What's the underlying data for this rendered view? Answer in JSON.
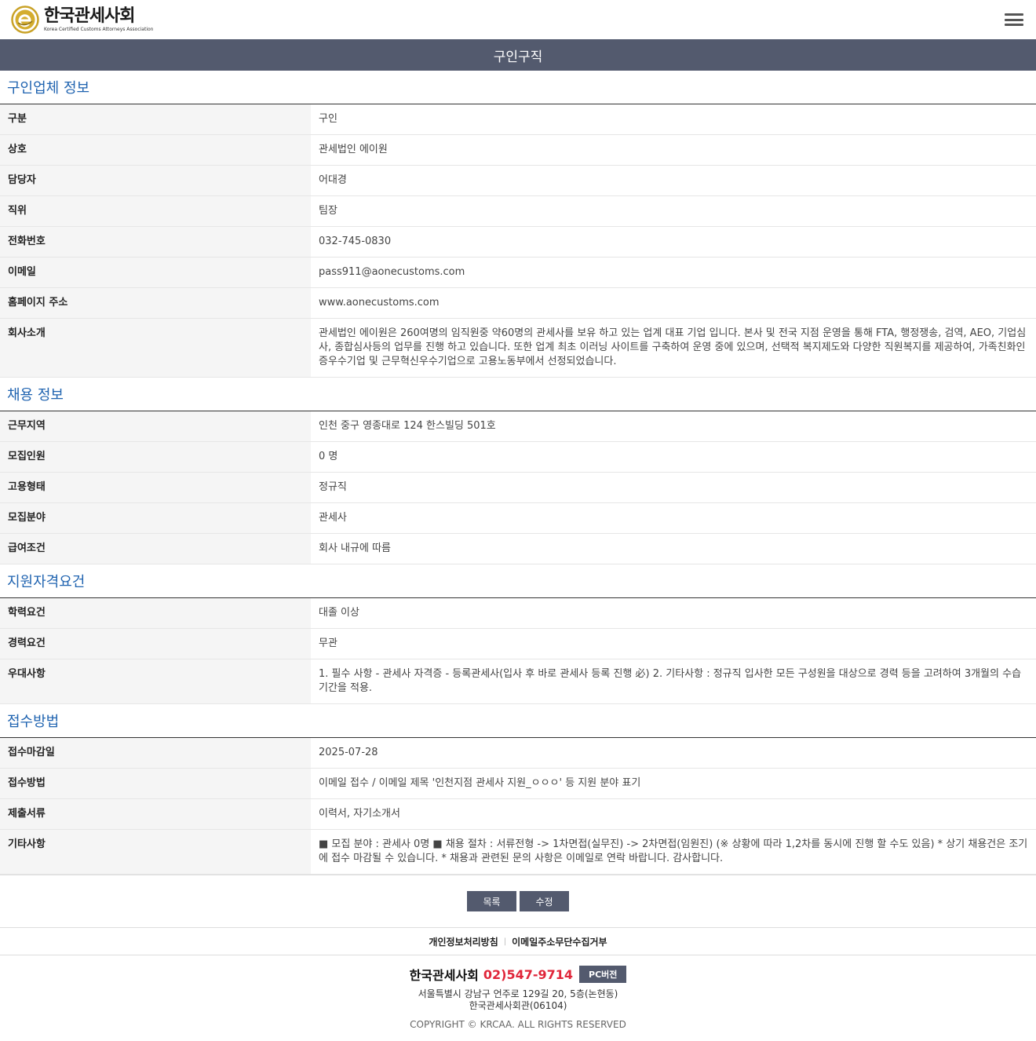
{
  "header": {
    "logo_ko": "한국관세사회",
    "logo_en": "Korea Certified Customs Attorneys Association"
  },
  "page_title": "구인구직",
  "sections": [
    {
      "title": "구인업체 정보",
      "rows": [
        {
          "label": "구분",
          "value": "구인"
        },
        {
          "label": "상호",
          "value": "관세법인 에이원"
        },
        {
          "label": "담당자",
          "value": "어대경"
        },
        {
          "label": "직위",
          "value": "팀장"
        },
        {
          "label": "전화번호",
          "value": "032-745-0830"
        },
        {
          "label": "이메일",
          "value": "pass911@aonecustoms.com"
        },
        {
          "label": "홈페이지 주소",
          "value": "www.aonecustoms.com"
        },
        {
          "label": "회사소개",
          "value": "관세법인 에이원은 260여명의 임직원중 약60명의 관세사를 보유 하고 있는 업계 대표 기업 입니다. 본사 및 전국 지점 운영을 통해 FTA, 행정쟁송, 검역, AEO, 기업심사, 종합심사등의 업무를 진행 하고 있습니다. 또한 업계 최초 이러닝 사이트를 구축하여 운영 중에 있으며, 선택적 복지제도와 다양한 직원복지를 제공하여, 가족친화인증우수기업 및 근무혁신우수기업으로 고용노동부에서 선정되었습니다."
        }
      ]
    },
    {
      "title": "채용 정보",
      "rows": [
        {
          "label": "근무지역",
          "value": "인천 중구 영종대로 124 한스빌딩 501호"
        },
        {
          "label": "모집인원",
          "value": "0 명"
        },
        {
          "label": "고용형태",
          "value": "정규직"
        },
        {
          "label": "모집분야",
          "value": "관세사"
        },
        {
          "label": "급여조건",
          "value": "회사 내규에 따름"
        }
      ]
    },
    {
      "title": "지원자격요건",
      "rows": [
        {
          "label": "학력요건",
          "value": "대졸 이상"
        },
        {
          "label": "경력요건",
          "value": "무관"
        },
        {
          "label": "우대사항",
          "value": "1. 필수 사항 - 관세사 자격증 - 등록관세사(입사 후 바로 관세사 등록 진행 必) 2. 기타사항 : 정규직 입사한 모든 구성원을 대상으로 경력 등을 고려하여 3개월의 수습기간을 적용."
        }
      ]
    },
    {
      "title": "접수방법",
      "rows": [
        {
          "label": "접수마감일",
          "value": "2025-07-28"
        },
        {
          "label": "접수방법",
          "value": "이메일 접수 / 이메일 제목 '인천지점 관세사 지원_ㅇㅇㅇ' 등 지원 분야 표기"
        },
        {
          "label": "제출서류",
          "value": "이력서, 자기소개서"
        },
        {
          "label": "기타사항",
          "value": "■ 모집 분야 : 관세사 0명 ■ 채용 절차 : 서류전형 -> 1차면접(실무진) -> 2차면접(임원진) (※ 상황에 따라 1,2차를 동시에 진행 할 수도 있음) * 상기 채용건은 조기에 접수 마감될 수 있습니다. * 채용과 관련된 문의 사항은 이메일로 연락 바랍니다. 감사합니다."
        }
      ]
    }
  ],
  "buttons": {
    "list_label": "목록",
    "edit_label": "수정"
  },
  "footer": {
    "privacy_link": "개인정보처리방침",
    "email_link": "이메일주소무단수집거부",
    "org_name": "한국관세사회",
    "phone": "02)547-9714",
    "pc_version": "PC버전",
    "address_line1": "서울특별시 강남구 언주로 129길 20, 5층(논현동)",
    "address_line2": "한국관세사회관(06104)",
    "copyright": "COPYRIGHT © KRCAA. ALL RIGHTS RESERVED"
  },
  "colors": {
    "banner": "#535a6e",
    "section_title": "#1f63b0",
    "phone": "#e0263a",
    "logo_gold": "#c9a227"
  },
  "icons": {
    "logo": "krcaa-logo-icon",
    "menu": "hamburger-menu-icon"
  }
}
